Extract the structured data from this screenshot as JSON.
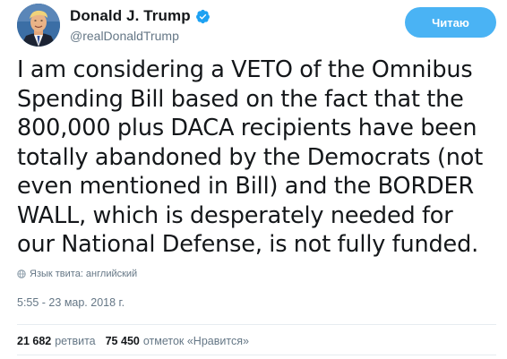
{
  "author": {
    "display_name": "Donald J. Trump",
    "handle": "@realDonaldTrump",
    "verified": true,
    "avatar_icon": "profile-avatar"
  },
  "follow_button": {
    "label": "Читаю",
    "color": "#4ab3f4"
  },
  "tweet": {
    "text": "I am considering a VETO of the Omnibus Spending Bill based on the fact that the 800,000 plus DACA recipients have been totally abandoned by the Democrats (not even mentioned in Bill) and the BORDER WALL, which is desperately needed for our National Defense, is not fully funded.",
    "language_label": "Язык твита: английский",
    "timestamp": "5:55 - 23 мар. 2018 г."
  },
  "stats": {
    "retweets_count": "21 682",
    "retweets_label": "ретвита",
    "likes_count": "75 450",
    "likes_label": "отметок «Нравится»"
  },
  "colors": {
    "text": "#14171a",
    "secondary": "#657786",
    "verified_blue": "#1da1f2",
    "divider": "#e6ecf0"
  }
}
